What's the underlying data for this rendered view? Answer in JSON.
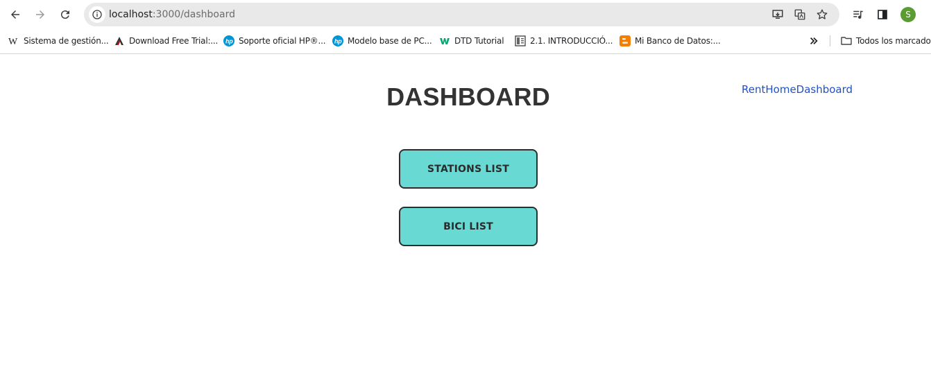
{
  "browser": {
    "url_host": "localhost",
    "url_path": ":3000/dashboard",
    "avatar_letter": "S",
    "icons": [
      "back-arrow-icon",
      "forward-arrow-icon",
      "reload-icon",
      "site-info-icon",
      "install-app-icon",
      "translate-icon",
      "bookmark-star-icon",
      "media-controls-icon",
      "side-panel-icon",
      "profile-avatar"
    ]
  },
  "bookmarks": {
    "items": [
      {
        "label": "Sistema de gestión...",
        "icon": "wikipedia-icon"
      },
      {
        "label": "Download Free Trial:...",
        "icon": "autodesk-icon"
      },
      {
        "label": "Soporte oficial HP®...",
        "icon": "hp-icon"
      },
      {
        "label": "Modelo base de PC...",
        "icon": "hp-icon"
      },
      {
        "label": "DTD Tutorial",
        "icon": "w3schools-icon"
      },
      {
        "label": "2.1. INTRODUCCIÓ...",
        "icon": "document-icon"
      },
      {
        "label": "Mi Banco de Datos:...",
        "icon": "blogger-icon"
      }
    ],
    "all_bookmarks_label": "Todos los marcadores"
  },
  "page": {
    "title": "DASHBOARD",
    "nav": {
      "rent": "Rent",
      "home": "Home",
      "dashboard": "Dashboard"
    },
    "buttons": {
      "stations": "STATIONS LIST",
      "bici": "BICI LIST"
    }
  },
  "colors": {
    "button_bg": "#68d9d3",
    "button_border": "#2d2d2d",
    "link": "#2050c8",
    "title": "#333333",
    "avatar": "#5a9c32"
  }
}
